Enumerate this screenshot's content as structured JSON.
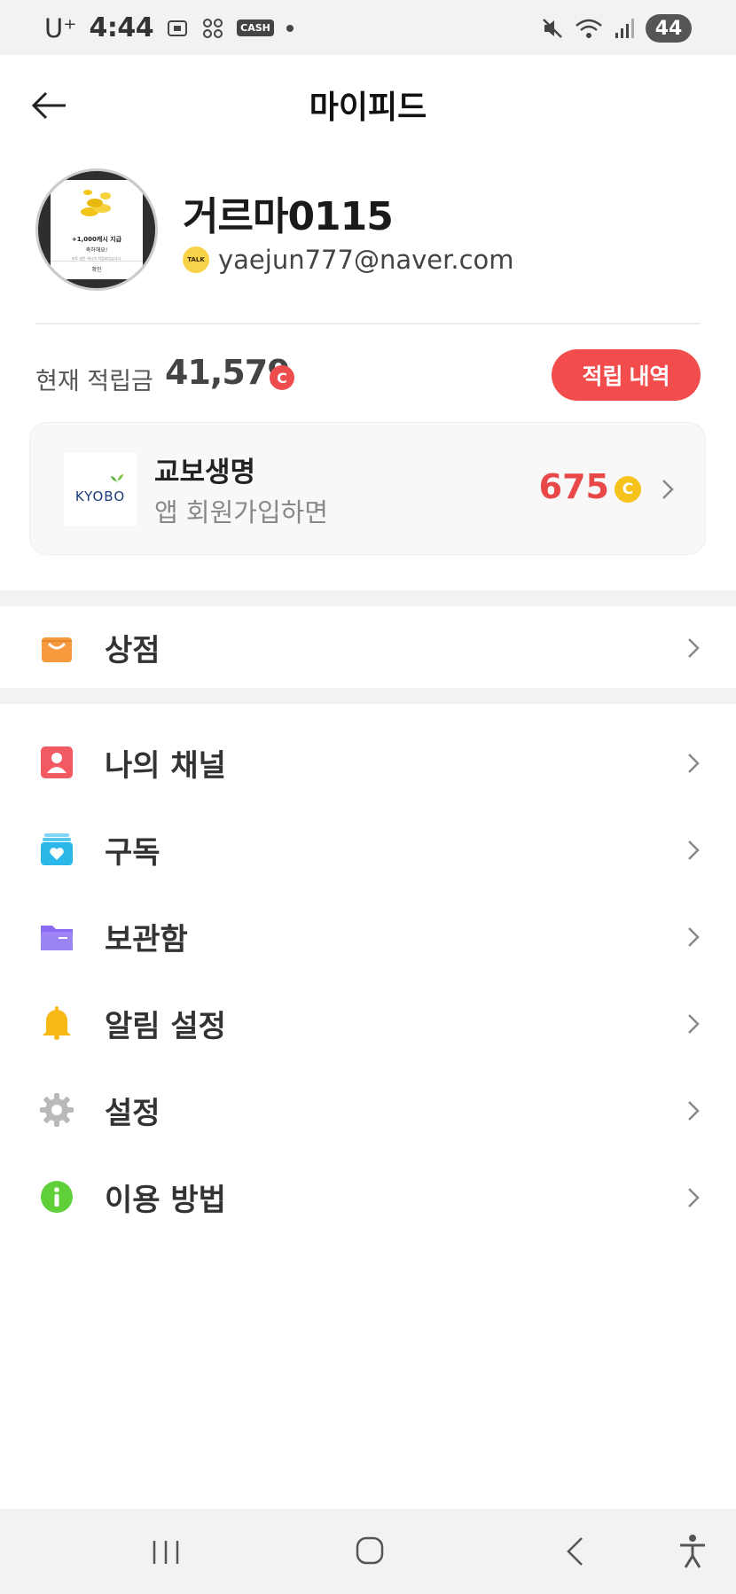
{
  "status_bar": {
    "carrier": "U⁺",
    "time": "4:44",
    "cash_label": "CASH",
    "battery": "44"
  },
  "header": {
    "title": "마이피드"
  },
  "profile": {
    "username": "거르마0115",
    "email": "yaejun777@naver.com",
    "talk_badge": "TALK",
    "avatar_popup": {
      "line1": "+1,000캐시 지급",
      "line2": "축하해요!",
      "line3": "포토 방문 캐시가 적립되었습니다.",
      "confirm": "확인"
    }
  },
  "points": {
    "label": "현재 적립금",
    "value": "41,579",
    "coin_symbol": "C",
    "history_button": "적립 내역"
  },
  "ad": {
    "logo_text": "KYOBO",
    "title": "교보생명",
    "subtitle": "앱 회원가입하면",
    "points": "675",
    "coin_symbol": "C"
  },
  "menu": {
    "store": {
      "label": "상점",
      "icon": "shopping-bag-icon",
      "color": "#f79a3e"
    },
    "items": [
      {
        "label": "나의 채널",
        "icon": "person-icon",
        "color": "#f25a63"
      },
      {
        "label": "구독",
        "icon": "subscribe-heart-icon",
        "color": "#2bb8e8"
      },
      {
        "label": "보관함",
        "icon": "folder-icon",
        "color": "#8a6cf0"
      },
      {
        "label": "알림 설정",
        "icon": "bell-icon",
        "color": "#f7b916"
      },
      {
        "label": "설정",
        "icon": "gear-icon",
        "color": "#b9b9b9"
      },
      {
        "label": "이용 방법",
        "icon": "info-icon",
        "color": "#5fcf3a"
      }
    ]
  },
  "colors": {
    "accent_red": "#f24c4c",
    "coin_yellow": "#f6c21c",
    "separator": "#f2f2f4"
  }
}
